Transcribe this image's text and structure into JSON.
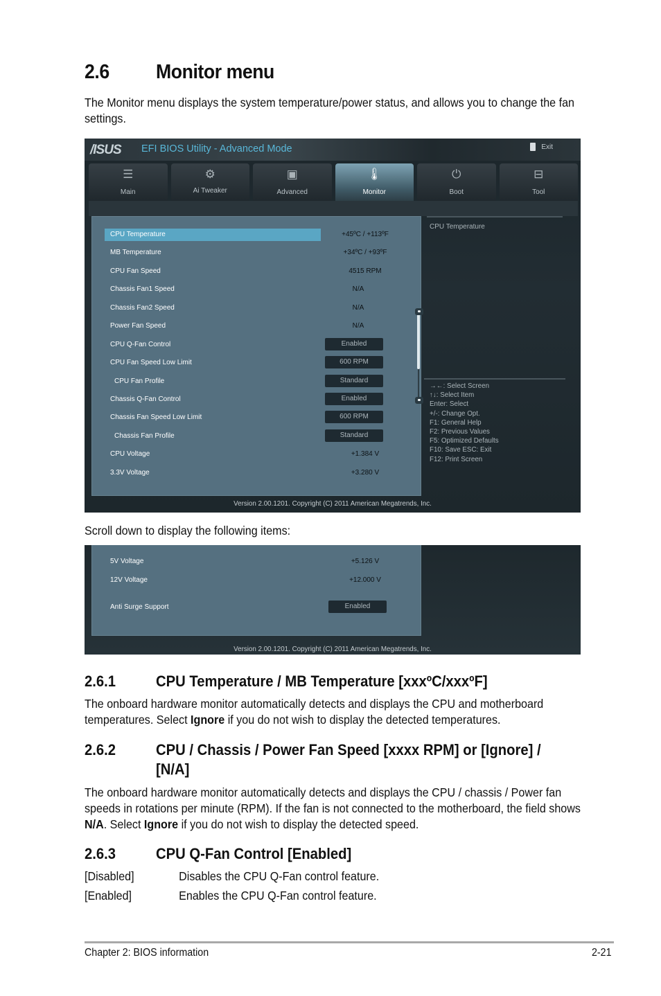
{
  "section": {
    "number": "2.6",
    "title": "Monitor menu",
    "intro": "The Monitor menu displays the system temperature/power status, and allows you to change the fan settings."
  },
  "bios": {
    "logo": "/ISUS",
    "title": "EFI BIOS Utility - Advanced Mode",
    "exit_label": "Exit",
    "tabs": [
      {
        "label": "Main",
        "icon": "list-icon",
        "active": false
      },
      {
        "label": "Ai  Tweaker",
        "icon": "tweaker-icon",
        "active": false
      },
      {
        "label": "Advanced",
        "icon": "advanced-icon",
        "active": false
      },
      {
        "label": "Monitor",
        "icon": "monitor-icon",
        "active": true
      },
      {
        "label": "Boot",
        "icon": "power-icon",
        "active": false
      },
      {
        "label": "Tool",
        "icon": "toolbox-icon",
        "active": false
      }
    ],
    "items": [
      {
        "label": "CPU Temperature",
        "value": "+45ºC / +113ºF",
        "type": "readout",
        "selected": true
      },
      {
        "label": "MB Temperature",
        "value": "+34ºC / +93ºF",
        "type": "readout"
      },
      {
        "label": "CPU Fan Speed",
        "value": "4515 RPM",
        "type": "readout"
      },
      {
        "label": "Chassis Fan1 Speed",
        "value": "N/A",
        "type": "readout"
      },
      {
        "label": "Chassis Fan2 Speed",
        "value": "N/A",
        "type": "readout"
      },
      {
        "label": "Power Fan Speed",
        "value": "N/A",
        "type": "readout"
      },
      {
        "label": "CPU Q-Fan Control",
        "value": "Enabled",
        "type": "option"
      },
      {
        "label": "CPU Fan Speed Low Limit",
        "value": "600 RPM",
        "type": "option"
      },
      {
        "label": "CPU Fan Profile",
        "value": "Standard",
        "type": "option",
        "sub": true
      },
      {
        "label": "Chassis Q-Fan Control",
        "value": "Enabled",
        "type": "option"
      },
      {
        "label": "Chassis Fan Speed Low Limit",
        "value": "600 RPM",
        "type": "option"
      },
      {
        "label": "Chassis Fan Profile",
        "value": "Standard",
        "type": "option",
        "sub": true
      },
      {
        "label": "CPU Voltage",
        "value": "+1.384 V",
        "type": "readout"
      },
      {
        "label": "3.3V Voltage",
        "value": "+3.280 V",
        "type": "readout"
      }
    ],
    "help_text": "CPU Temperature",
    "keys": [
      "→←:  Select Screen",
      "↑↓:  Select Item",
      "Enter:  Select",
      "+/-:  Change Opt.",
      "F1:  General Help",
      "F2:  Previous Values",
      "F5:  Optimized Defaults",
      "F10:  Save    ESC:  Exit",
      "F12:  Print Screen"
    ],
    "footer": "Version  2.00.1201.  Copyright  (C)  2011  American  Megatrends,  Inc."
  },
  "scroll_note": "Scroll down to display the following items:",
  "bios_scrolled": {
    "items": [
      {
        "label": "5V Voltage",
        "value": "+5.126 V",
        "type": "readout"
      },
      {
        "label": "12V Voltage",
        "value": "+12.000 V",
        "type": "readout"
      },
      {
        "label": "Anti Surge Support",
        "value": "Enabled",
        "type": "option"
      }
    ],
    "footer": "Version  2.00.1201.  Copyright  (C)  2011  American  Megatrends,  Inc."
  },
  "subsections": [
    {
      "number": "2.6.1",
      "title": "CPU Temperature / MB Temperature [xxxºC/xxxºF]",
      "body_parts": [
        "The onboard hardware monitor automatically detects and displays the CPU and motherboard temperatures. Select ",
        "Ignore",
        " if you do not wish to display the detected temperatures."
      ]
    },
    {
      "number": "2.6.2",
      "title": "CPU / Chassis / Power Fan Speed [xxxx RPM] or [Ignore] / [N/A]",
      "body_parts": [
        "The onboard hardware monitor automatically detects and displays the CPU / chassis / Power fan speeds in rotations per minute (RPM). If the fan is not connected to the motherboard, the field shows ",
        "N/A",
        ". Select ",
        "Ignore",
        " if you do not wish to display the detected speed."
      ]
    },
    {
      "number": "2.6.3",
      "title": "CPU Q-Fan Control [Enabled]",
      "options": [
        {
          "key": "[Disabled]",
          "desc": "Disables the CPU Q-Fan control feature."
        },
        {
          "key": "[Enabled]",
          "desc": "Enables the CPU Q-Fan control feature."
        }
      ]
    }
  ],
  "page_footer": {
    "chapter": "Chapter 2: BIOS information",
    "page": "2-21"
  }
}
